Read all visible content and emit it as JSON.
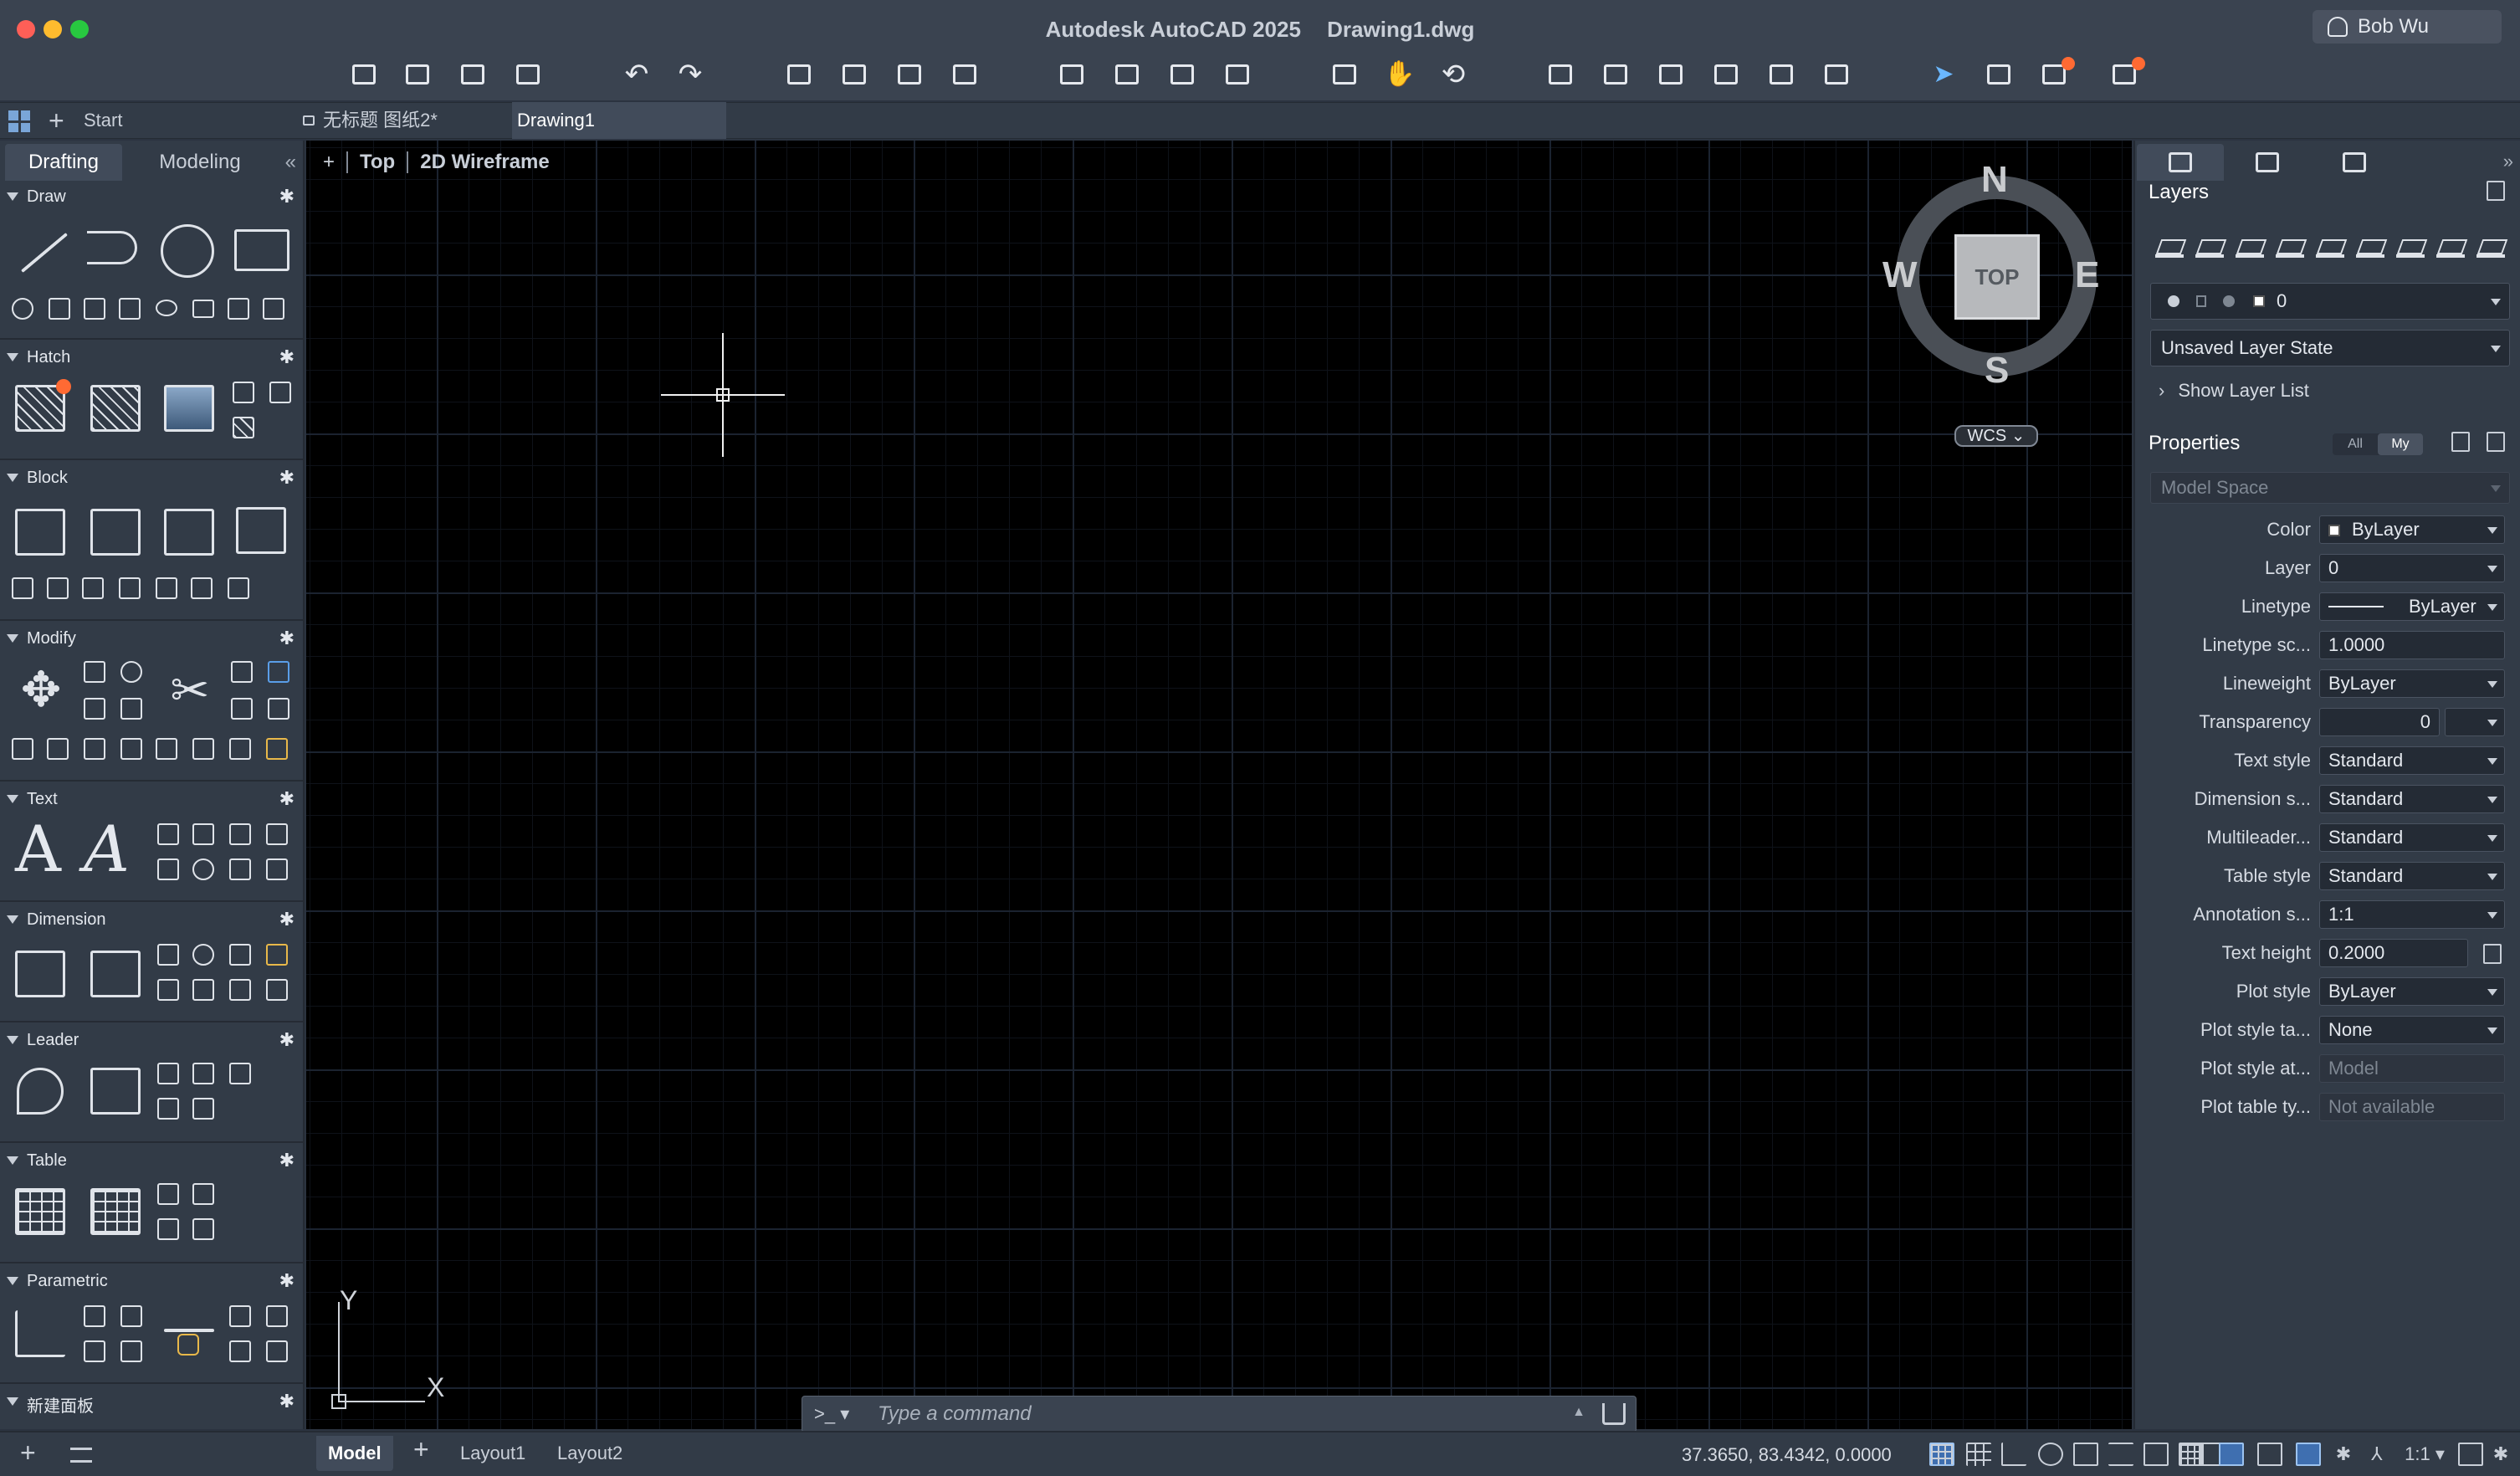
{
  "window": {
    "app_title": "Autodesk AutoCAD 2025",
    "document_title": "Drawing1.dwg",
    "user": "Bob Wu"
  },
  "tabs": {
    "start": "Start",
    "untitled": "无标题 图纸2*",
    "drawing1": "Drawing1"
  },
  "left_palette": {
    "workspace_tabs": [
      "Drafting",
      "Modeling"
    ],
    "collapse": "«",
    "sections": [
      "Draw",
      "Hatch",
      "Block",
      "Modify",
      "Text",
      "Dimension",
      "Leader",
      "Table",
      "Parametric",
      "新建面板"
    ],
    "text_glyph": "A"
  },
  "viewport": {
    "plus": "+",
    "view": "Top",
    "visual_style": "2D Wireframe"
  },
  "viewcube": {
    "face": "TOP",
    "north": "N",
    "south": "S",
    "east": "E",
    "west": "W",
    "wcs": "WCS"
  },
  "ucs": {
    "x": "X",
    "y": "Y"
  },
  "command_line": {
    "prompt": ">_",
    "placeholder": "Type a command"
  },
  "right_palette": {
    "layers_title": "Layers",
    "current_layer": "0",
    "layer_state": "Unsaved Layer State",
    "show_layer_list": "Show Layer List",
    "properties_title": "Properties",
    "filter_all": "All",
    "filter_my": "My",
    "space": "Model Space",
    "properties": [
      {
        "label": "Color",
        "value": "ByLayer"
      },
      {
        "label": "Layer",
        "value": "0"
      },
      {
        "label": "Linetype",
        "value": "ByLayer"
      },
      {
        "label": "Linetype sc...",
        "value": "1.0000"
      },
      {
        "label": "Lineweight",
        "value": "ByLayer"
      },
      {
        "label": "Transparency",
        "value": "0"
      },
      {
        "label": "Text style",
        "value": "Standard"
      },
      {
        "label": "Dimension s...",
        "value": "Standard"
      },
      {
        "label": "Multileader...",
        "value": "Standard"
      },
      {
        "label": "Table style",
        "value": "Standard"
      },
      {
        "label": "Annotation s...",
        "value": "1:1"
      },
      {
        "label": "Text height",
        "value": "0.2000"
      },
      {
        "label": "Plot style",
        "value": "ByLayer"
      },
      {
        "label": "Plot style ta...",
        "value": "None"
      },
      {
        "label": "Plot style at...",
        "value": "Model"
      },
      {
        "label": "Plot table ty...",
        "value": "Not available"
      }
    ]
  },
  "status_bar": {
    "layouts": [
      "Model",
      "Layout1",
      "Layout2"
    ],
    "plus": "+",
    "coordinates": "37.3650, 83.4342, 0.0000",
    "scale": "1:1"
  },
  "colors": {
    "accent": "#3f6fb0",
    "notification": "#ff6a33",
    "canvas": "#000000"
  }
}
